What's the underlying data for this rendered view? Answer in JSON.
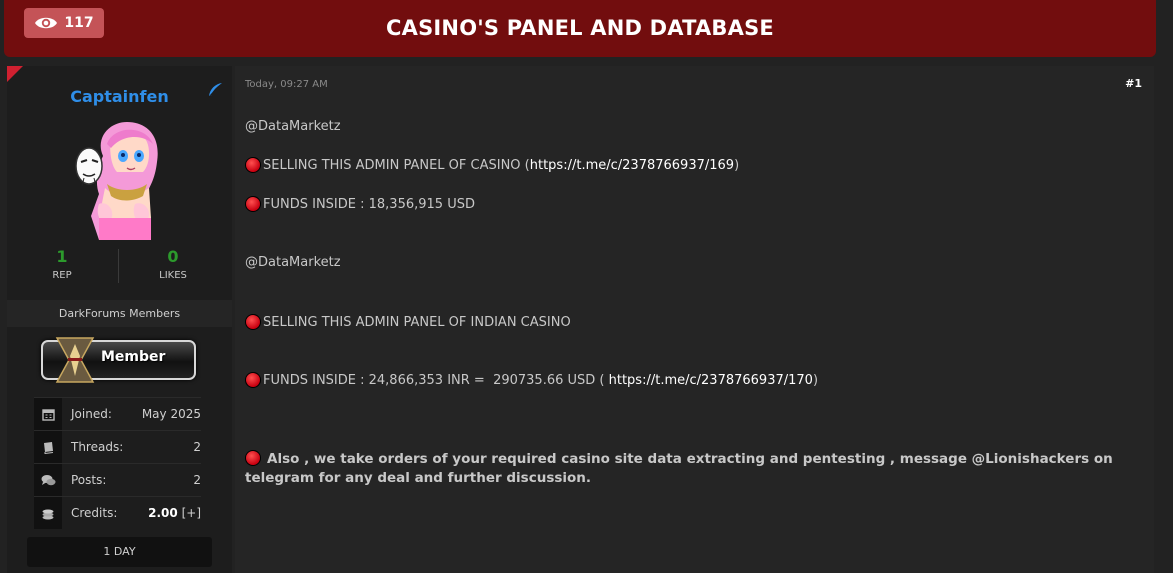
{
  "thread": {
    "title": "CASINO'S PANEL AND DATABASE",
    "views": "117"
  },
  "author": {
    "username": "Captainfen",
    "rep_value": "1",
    "rep_label": "REP",
    "likes_value": "0",
    "likes_label": "LIKES",
    "group": "DarkForums Members",
    "rank_badge": "Member",
    "info": [
      {
        "icon": "calendar-icon",
        "label": "Joined:",
        "value": "May 2025"
      },
      {
        "icon": "book-icon",
        "label": "Threads:",
        "value": "2"
      },
      {
        "icon": "chat-icon",
        "label": "Posts:",
        "value": "2"
      },
      {
        "icon": "coins-icon",
        "label": "Credits:",
        "value": "2.00",
        "extra": "[+]"
      }
    ],
    "duration": "1 DAY"
  },
  "post": {
    "date": "Today, 09:27 AM",
    "number": "#1",
    "lines": [
      {
        "text": "@DataMarketz"
      },
      {
        "text": "SELLING THIS ADMIN PANEL OF CASINO ( ",
        "link": "https://t.me/c/2378766937/169",
        "after": " )"
      },
      {
        "text": "FUNDS INSIDE : 18,356,915 USD"
      },
      {
        "text": "@DataMarketz"
      },
      {
        "text": "SELLING THIS ADMIN PANEL OF INDIAN CASINO"
      },
      {
        "text": "FUNDS INSIDE : 24,866,353 INR =  290735.66 USD ( ",
        "link": "https://t.me/c/2378766937/170",
        "after": " )"
      }
    ],
    "closing": "Also , we take orders of your required casino site data extracting and pentesting , message @Lionishackers on telegram for any deal and further discussion."
  },
  "colors": {
    "title_bar": "#720d0e",
    "badge": "#c45357",
    "username": "#2f8ee8",
    "stat_green": "#2c9a2c",
    "bullet_red": "#e0101e"
  }
}
